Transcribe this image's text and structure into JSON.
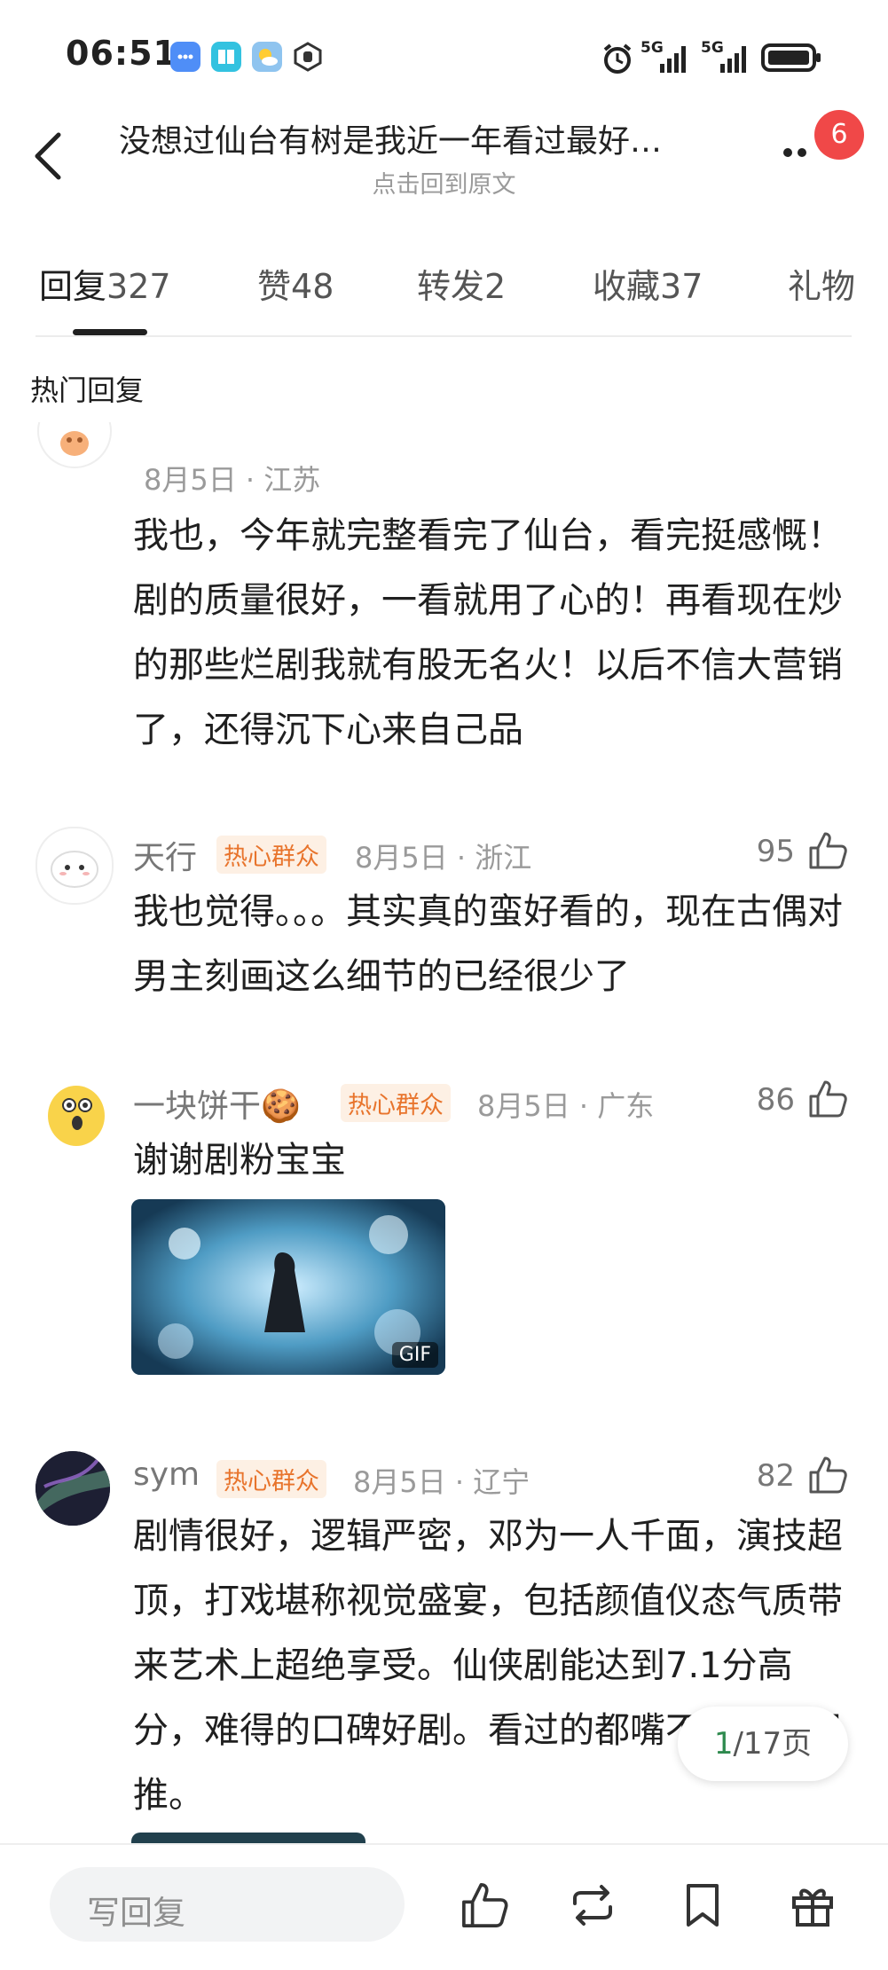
{
  "status_bar": {
    "time": "06:51",
    "signal_1": "5G",
    "signal_2": "5G"
  },
  "header": {
    "title": "没想过仙台有树是我近一年看过最好…",
    "subtitle": "点击回到原文",
    "badge": "6"
  },
  "tabs": [
    {
      "label": "回复",
      "count": "327"
    },
    {
      "label": "赞",
      "count": "48"
    },
    {
      "label": "转发",
      "count": "2"
    },
    {
      "label": "收藏",
      "count": "37"
    },
    {
      "label": "礼物",
      "count": ""
    }
  ],
  "section_title": "热门回复",
  "comments": [
    {
      "name": "",
      "tag": "",
      "date": "8月5日 · 江苏",
      "likes": "",
      "text": "我也，今年就完整看完了仙台，看完挺感慨！剧的质量很好，一看就用了心的！再看现在炒的那些烂剧我就有股无名火！以后不信大营销了，还得沉下心来自己品"
    },
    {
      "name": "天行",
      "tag": "热心群众",
      "date": "8月5日 · 浙江",
      "likes": "95",
      "text": "我也觉得。。。其实真的蛮好看的，现在古偶对男主刻画这么细节的已经很少了"
    },
    {
      "name": "一块饼干🍪",
      "tag": "热心群众",
      "date": "8月5日 · 广东",
      "likes": "86",
      "text": "谢谢剧粉宝宝",
      "gif_label": "GIF"
    },
    {
      "name": "sym",
      "tag": "热心群众",
      "date": "8月5日 · 辽宁",
      "likes": "82",
      "text": "剧情很好，逻辑严密，邓为一人千面，演技超顶，打戏堪称视觉盛宴，包括颜值仪态气质带来艺术上超绝享受。仙侠剧能达到7.1分高分，难得的口碑好剧。看过的都嘴不出口。强推。"
    }
  ],
  "pager": {
    "current": "1",
    "total": "/17页"
  },
  "bottom_bar": {
    "reply_placeholder": "写回复"
  },
  "icons": {
    "back": "back-arrow-icon",
    "more": "more-icon",
    "like": "thumbs-up-icon",
    "repost": "repost-icon",
    "bookmark": "bookmark-icon",
    "gift": "gift-icon"
  },
  "colors": {
    "accent_tag": "#e8742c",
    "badge": "#f04848",
    "pager_current": "#2e8a4e"
  }
}
